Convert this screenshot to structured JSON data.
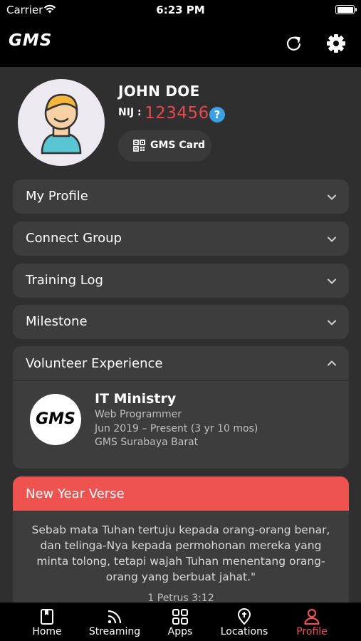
{
  "status_bar": {
    "carrier": "Carrier",
    "time": "6:23 PM"
  },
  "nav": {
    "logo": "GMS",
    "refresh_icon": "refresh-icon",
    "settings_icon": "gear-icon"
  },
  "profile": {
    "name": "JOHN DOE",
    "nij_label": "NIJ :",
    "nij_value": "123456",
    "help_symbol": "?",
    "card_button_label": "GMS Card"
  },
  "sections": [
    {
      "label": "My Profile"
    },
    {
      "label": "Connect Group"
    },
    {
      "label": "Training Log"
    },
    {
      "label": "Milestone"
    }
  ],
  "volunteer": {
    "header": "Volunteer Experience",
    "logo_text": "GMS",
    "ministry": "IT Ministry",
    "role": "Web Programmer",
    "period": "Jun 2019 – Present (3 yr 10 mos)",
    "location": "GMS Surabaya Barat"
  },
  "verse": {
    "header": "New Year Verse",
    "text": "Sebab mata Tuhan tertuju kepada orang-orang benar, dan telinga-Nya kepada permohonan mereka yang minta tolong, tetapi wajah Tuhan menentang orang-orang yang berbuat jahat.\"",
    "reference": "1 Petrus 3:12"
  },
  "tabs": [
    {
      "label": "Home",
      "icon": "book-icon"
    },
    {
      "label": "Streaming",
      "icon": "streaming-icon"
    },
    {
      "label": "Apps",
      "icon": "apps-grid-icon"
    },
    {
      "label": "Locations",
      "icon": "location-icon"
    },
    {
      "label": "Profile",
      "icon": "profile-icon",
      "active": true
    }
  ],
  "colors": {
    "accent": "#ef5350",
    "nij": "#e9484b",
    "help": "#3aa0e6",
    "card": "#3d3d3d",
    "background": "#2f2f2f"
  }
}
